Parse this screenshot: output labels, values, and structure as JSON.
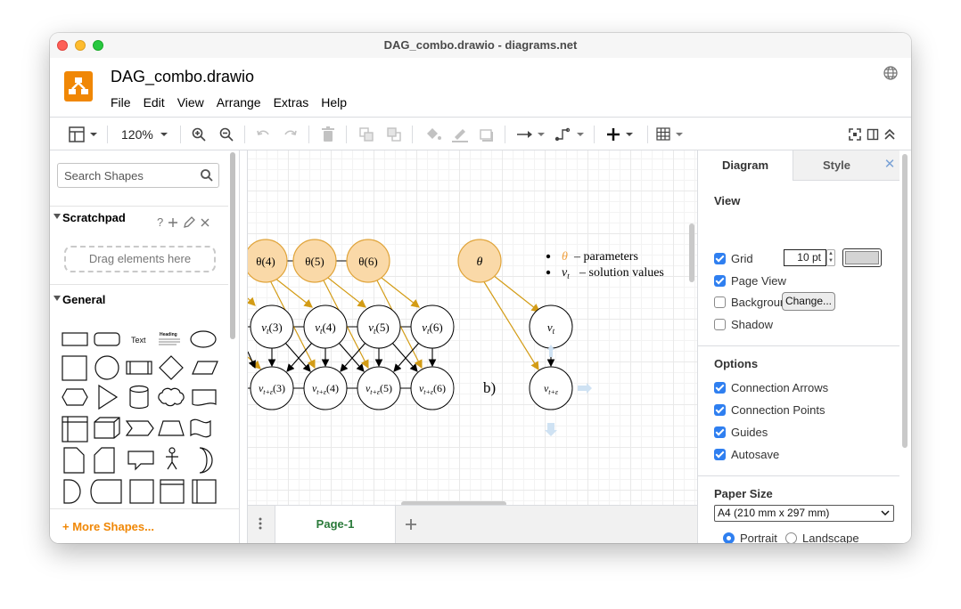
{
  "window": {
    "title": "DAG_combo.drawio - diagrams.net"
  },
  "header": {
    "filename": "DAG_combo.drawio",
    "menus": [
      "File",
      "Edit",
      "View",
      "Arrange",
      "Extras",
      "Help"
    ]
  },
  "toolbar": {
    "zoom": "120%"
  },
  "sidebar": {
    "search_placeholder": "Search Shapes",
    "scratchpad": {
      "title": "Scratchpad",
      "help": "?",
      "drop_text": "Drag elements here"
    },
    "general": {
      "title": "General"
    },
    "shape_text_label": "Text",
    "shape_heading_label": "Heading",
    "more_shapes": "+ More Shapes..."
  },
  "diagram": {
    "theta_nodes": [
      "θ(4)",
      "θ(5)",
      "θ(6)"
    ],
    "v_top_nodes": [
      "3",
      "4",
      "5",
      "6"
    ],
    "v_bottom_nodes": [
      "3",
      "4",
      "5",
      "6"
    ],
    "single_theta": "θ",
    "label_b": "b)",
    "legend": [
      {
        "symbol": "θ",
        "text": "– parameters"
      },
      {
        "symbol": "v",
        "sub": "t",
        "text": "– solution values"
      }
    ],
    "colors": {
      "theta_fill": "#fad9a8",
      "theta_stroke": "#e0a43a",
      "orange_edge": "#d39c16",
      "black_edge": "#000000",
      "hint_arrow": "#cfe2f3"
    }
  },
  "pages": {
    "active": "Page-1"
  },
  "panel": {
    "tabs": [
      "Diagram",
      "Style"
    ],
    "view": {
      "title": "View",
      "grid_label": "Grid",
      "grid_checked": true,
      "grid_size": "10 pt",
      "page_view_label": "Page View",
      "page_view_checked": true,
      "background_label": "Background",
      "background_checked": false,
      "change_button": "Change...",
      "shadow_label": "Shadow",
      "shadow_checked": false
    },
    "options": {
      "title": "Options",
      "items": [
        {
          "label": "Connection Arrows",
          "checked": true
        },
        {
          "label": "Connection Points",
          "checked": true
        },
        {
          "label": "Guides",
          "checked": true
        },
        {
          "label": "Autosave",
          "checked": true
        }
      ]
    },
    "paper": {
      "title": "Paper Size",
      "size": "A4 (210 mm x 297 mm)",
      "portrait": "Portrait",
      "landscape": "Landscape",
      "orientation": "Portrait"
    }
  }
}
